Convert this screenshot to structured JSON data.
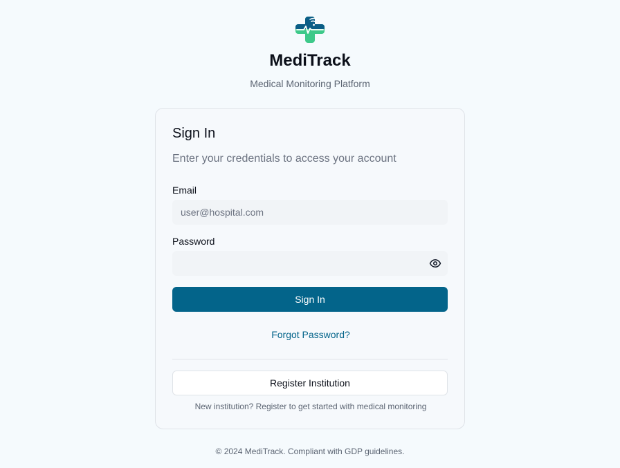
{
  "brand": {
    "name": "MediTrack",
    "tagline": "Medical Monitoring Platform",
    "logo_icon": "medical-cross-heartbeat-wifi-icon",
    "colors": {
      "primary": "#03648a",
      "accent_green": "#3ec98a",
      "background": "#f5fafd"
    }
  },
  "signin": {
    "title": "Sign In",
    "subtitle": "Enter your credentials to access your account",
    "email": {
      "label": "Email",
      "placeholder": "user@hospital.com",
      "value": ""
    },
    "password": {
      "label": "Password",
      "placeholder": "",
      "value": "",
      "toggle_icon": "eye-icon"
    },
    "submit_label": "Sign In",
    "forgot_label": "Forgot Password?",
    "register_label": "Register Institution",
    "register_note": "New institution? Register to get started with medical monitoring"
  },
  "footer": {
    "text": "© 2024 MediTrack. Compliant with GDP guidelines."
  }
}
